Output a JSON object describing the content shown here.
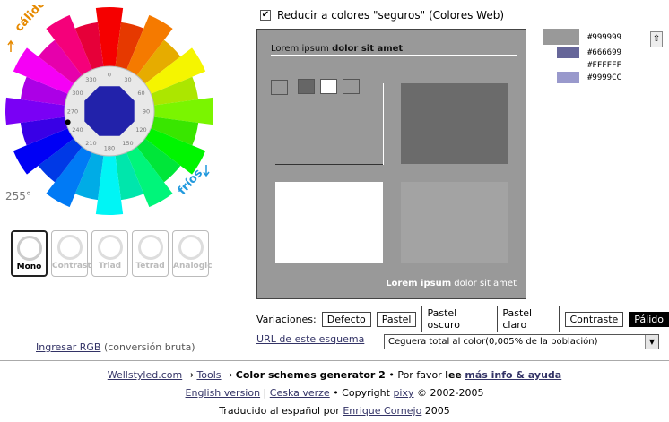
{
  "wheel": {
    "label_warm": "cálidos",
    "label_cool": "fríos",
    "degree_readout": "255°",
    "ring_ticks": [
      "0",
      "30",
      "60",
      "90",
      "120",
      "150",
      "180",
      "210",
      "240",
      "270",
      "300",
      "330"
    ],
    "selected_hue_deg": 255,
    "center_color": "#2222aa"
  },
  "schemes": [
    {
      "label": "Mono",
      "active": true
    },
    {
      "label": "Contrast",
      "active": false
    },
    {
      "label": "Triad",
      "active": false
    },
    {
      "label": "Tetrad",
      "active": false
    },
    {
      "label": "Analogic",
      "active": false
    }
  ],
  "ingresar": {
    "link": "Ingresar RGB",
    "note": "(conversión bruta)"
  },
  "web_colors": {
    "checked_mark": "✔",
    "label": "Reducir a colores \"seguros\" (Colores Web)"
  },
  "preview": {
    "title_plain": "Lorem ipsum ",
    "title_bold": "dolor sit amet",
    "footer_bold": "Lorem ipsum",
    "footer_plain": " dolor sit amet",
    "bg": "#999999"
  },
  "palette": [
    {
      "hex": "#999999",
      "color": "#999999"
    },
    {
      "hex": "#666699",
      "color": "#666699"
    },
    {
      "hex": "#FFFFFF",
      "color": "#FFFFFF"
    },
    {
      "hex": "#9999CC",
      "color": "#9999CC"
    }
  ],
  "scroll_up": "⇧",
  "variations": {
    "label": "Variaciones:",
    "items": [
      {
        "label": "Defecto",
        "active": false
      },
      {
        "label": "Pastel",
        "active": false
      },
      {
        "label": "Pastel oscuro",
        "active": false
      },
      {
        "label": "Pastel claro",
        "active": false
      },
      {
        "label": "Contraste",
        "active": false
      },
      {
        "label": "Pálido",
        "active": true
      }
    ]
  },
  "url_link": "URL de este esquema",
  "blind_select": {
    "value": "Ceguera total al color(0,005% de la población)",
    "arrow": "▼"
  },
  "footer": {
    "line1": {
      "site": "Wellstyled.com",
      "arrow1": " → ",
      "tools": "Tools",
      "arrow2": " → ",
      "current": "Color schemes generator 2",
      "mid": " • Por favor ",
      "lee": "lee",
      "space": " ",
      "more": "más info & ayuda"
    },
    "line2": {
      "english": "English version",
      "sep": " | ",
      "czech": "Ceska verze",
      "copy": " • Copyright ",
      "pixy": "pixy",
      "years": " © 2002-2005"
    },
    "line3": {
      "text": "Traducido al español por ",
      "translator": "Enrique Cornejo",
      "year": " 2005"
    }
  }
}
